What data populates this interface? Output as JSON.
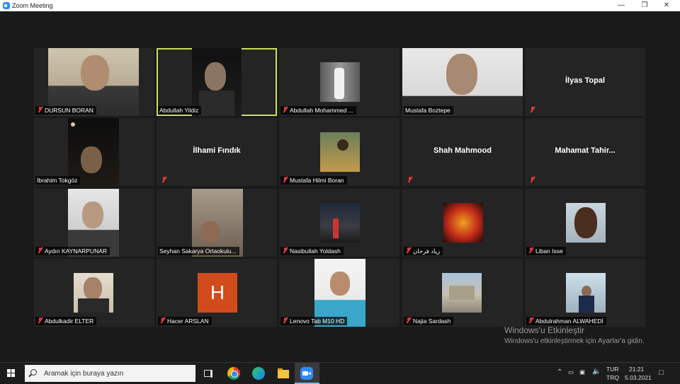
{
  "window": {
    "title": "Zoom Meeting"
  },
  "participants": [
    {
      "name": "DURSUN BORAN"
    },
    {
      "name": "Abdullah Yildiz"
    },
    {
      "name": "Abdullah Mohammed ..."
    },
    {
      "name": "Mustafa Boztepe"
    },
    {
      "name": "İlyas Topal"
    },
    {
      "name": "İbrahim Tokgöz"
    },
    {
      "name": "İlhami  Fındık"
    },
    {
      "name": "Mustafa Hilmi Boran"
    },
    {
      "name": "Shah Mahmood"
    },
    {
      "name": "Mahamat  Tahir..."
    },
    {
      "name": "Aydın KAYNARPUNAR"
    },
    {
      "name": "Seyhan Sakarya Ortaokulu..."
    },
    {
      "name": "Nasibullah Yoldash"
    },
    {
      "name": "زیاد فرحان"
    },
    {
      "name": "Liban Isse"
    },
    {
      "name": "Abdulkadir ELTER"
    },
    {
      "name": "Hacer ARSLAN",
      "avatar_letter": "H"
    },
    {
      "name": "Lenovo Tab M10 HD"
    },
    {
      "name": "Najia Sardash"
    },
    {
      "name": "Abdulrahman ALWAHEDİ"
    }
  ],
  "watermark": {
    "title": "Windows'u Etkinleştir",
    "subtitle": "Windows'u etkinleştirmek için Ayarlar'a gidin."
  },
  "taskbar": {
    "search_placeholder": "Aramak için buraya yazın",
    "lang_top": "TUR",
    "lang_bottom": "TRQ",
    "time": "21:21",
    "date": "5.03.2021"
  },
  "colors": {
    "active_speaker": "#c8e055",
    "muted": "#e03b3b",
    "zoom_blue": "#2d8cff",
    "avatar_h": "#d24b1c"
  }
}
